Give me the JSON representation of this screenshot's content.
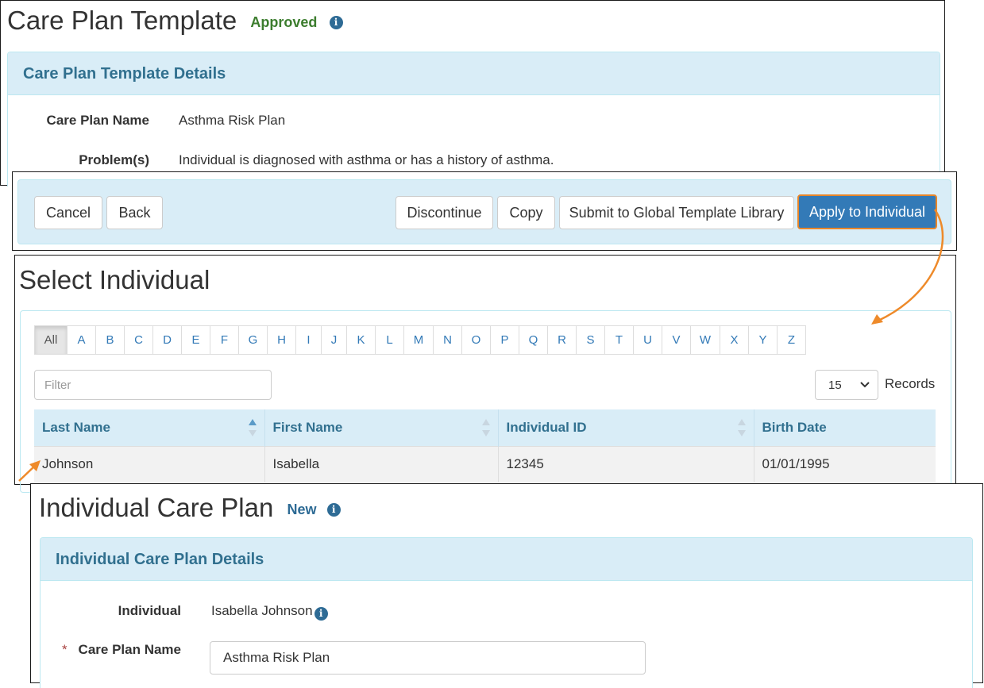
{
  "template": {
    "title": "Care Plan Template",
    "status": "Approved",
    "panel_heading": "Care Plan Template Details",
    "fields": [
      {
        "label": "Care Plan Name",
        "value": "Asthma Risk Plan"
      },
      {
        "label": "Problem(s)",
        "value": "Individual is diagnosed with asthma or has a history of asthma."
      }
    ]
  },
  "actions": {
    "cancel": "Cancel",
    "back": "Back",
    "discontinue": "Discontinue",
    "copy": "Copy",
    "submit": "Submit to Global Template Library",
    "apply": "Apply to Individual"
  },
  "select": {
    "title": "Select Individual",
    "letters": [
      "All",
      "A",
      "B",
      "C",
      "D",
      "E",
      "F",
      "G",
      "H",
      "I",
      "J",
      "K",
      "L",
      "M",
      "N",
      "O",
      "P",
      "Q",
      "R",
      "S",
      "T",
      "U",
      "V",
      "W",
      "X",
      "Y",
      "Z"
    ],
    "active_letter": "All",
    "filter_placeholder": "Filter",
    "records_value": "15",
    "records_label": "Records",
    "columns": [
      "Last Name",
      "First Name",
      "Individual ID",
      "Birth Date"
    ],
    "rows": [
      [
        "Johnson",
        "Isabella",
        "12345",
        "01/01/1995"
      ]
    ]
  },
  "individual_plan": {
    "title": "Individual Care Plan",
    "status": "New",
    "panel_heading": "Individual Care Plan Details",
    "individual_label": "Individual",
    "individual_value": "Isabella Johnson",
    "required_mark": "*",
    "name_label": "Care Plan Name",
    "name_value": "Asthma Risk Plan"
  },
  "colors": {
    "approved": "#3c7d2e",
    "new": "#2e6b95",
    "panel_heading_bg": "#d9edf7",
    "panel_heading_text": "#31708f",
    "primary": "#337ab7",
    "arrow": "#ee8a2a",
    "required": "#a94442"
  }
}
